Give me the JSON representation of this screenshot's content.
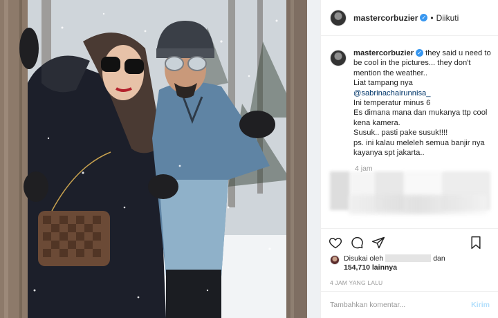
{
  "post": {
    "username": "mastercorbuzier",
    "separator": "•",
    "follow_status": "Diikuti",
    "verified_icon": "verified-badge-icon",
    "caption_lines": [
      "they said u need to be cool in the pictures... they don't mention the weather..",
      "Liat tampang nya",
      "@sabrinachairunnisa_",
      "Ini temperatur minus 6",
      "Es dimana mana dan mukanya ttp cool kena kamera.",
      "Susuk.. pasti pake susuk!!!!",
      "ps. ini kalau meleleh semua banjir nya kayanya spt jakarta.."
    ],
    "caption_time": "4 jam",
    "likes_prefix": "Disukai oleh",
    "likes_and": "dan",
    "likes_count": "154,710",
    "likes_suffix": "lainnya",
    "timestamp": "4 JAM YANG LALU",
    "comment_placeholder": "Tambahkan komentar...",
    "send_label": "Kirim",
    "colors": {
      "verified": "#3897f0",
      "mention": "#003569",
      "send_disabled": "#b2dffc",
      "secondary_text": "#999999"
    },
    "icons": [
      "heart-icon",
      "comment-icon",
      "share-icon",
      "bookmark-icon"
    ]
  }
}
